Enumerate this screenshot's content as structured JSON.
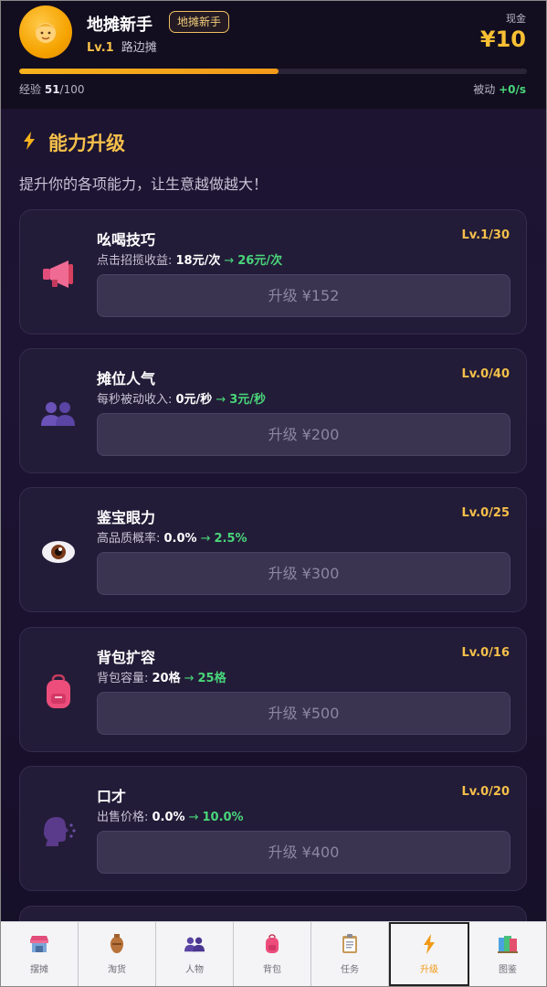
{
  "header": {
    "player_name": "地摊新手",
    "title_badge": "地摊新手",
    "level": "Lv.1",
    "stall_type": "路边摊",
    "cash_label": "现金",
    "cash_value": "¥10",
    "xp_label": "经验",
    "xp_current": "51",
    "xp_max": "/100",
    "xp_progress": 0.51,
    "passive_label": "被动",
    "passive_value": "+0/s"
  },
  "section": {
    "icon": "lightning-icon",
    "title": "能力升级",
    "subtitle": "提升你的各项能力，让生意越做越大！"
  },
  "upgrades": [
    {
      "name": "吆喝技巧",
      "level": "Lv.1/30",
      "desc_label": "点击招揽收益: ",
      "current": "18元/次",
      "next": "26元/次",
      "button": "升级 ¥152",
      "icon": "megaphone-icon"
    },
    {
      "name": "摊位人气",
      "level": "Lv.0/40",
      "desc_label": "每秒被动收入: ",
      "current": "0元/秒",
      "next": "3元/秒",
      "button": "升级 ¥200",
      "icon": "people-icon"
    },
    {
      "name": "鉴宝眼力",
      "level": "Lv.0/25",
      "desc_label": "高品质概率: ",
      "current": "0.0%",
      "next": "2.5%",
      "button": "升级 ¥300",
      "icon": "eye-icon"
    },
    {
      "name": "背包扩容",
      "level": "Lv.0/16",
      "desc_label": "背包容量: ",
      "current": "20格",
      "next": "25格",
      "button": "升级 ¥500",
      "icon": "backpack-icon"
    },
    {
      "name": "口才",
      "level": "Lv.0/20",
      "desc_label": "出售价格: ",
      "current": "0.0%",
      "next": "10.0%",
      "button": "升级 ¥400",
      "icon": "speaking-head-icon"
    }
  ],
  "arrow": "→",
  "tabs": [
    {
      "label": "摆摊",
      "icon": "stall-icon"
    },
    {
      "label": "淘货",
      "icon": "vase-icon"
    },
    {
      "label": "人物",
      "icon": "people-icon"
    },
    {
      "label": "背包",
      "icon": "backpack-icon"
    },
    {
      "label": "任务",
      "icon": "clipboard-icon"
    },
    {
      "label": "升级",
      "icon": "lightning-icon",
      "active": true
    },
    {
      "label": "图鉴",
      "icon": "books-icon"
    }
  ],
  "colors": {
    "accent": "#f6c04a",
    "positive": "#49d67a",
    "active_tab": "#f29a16",
    "background": "#1c1430"
  }
}
